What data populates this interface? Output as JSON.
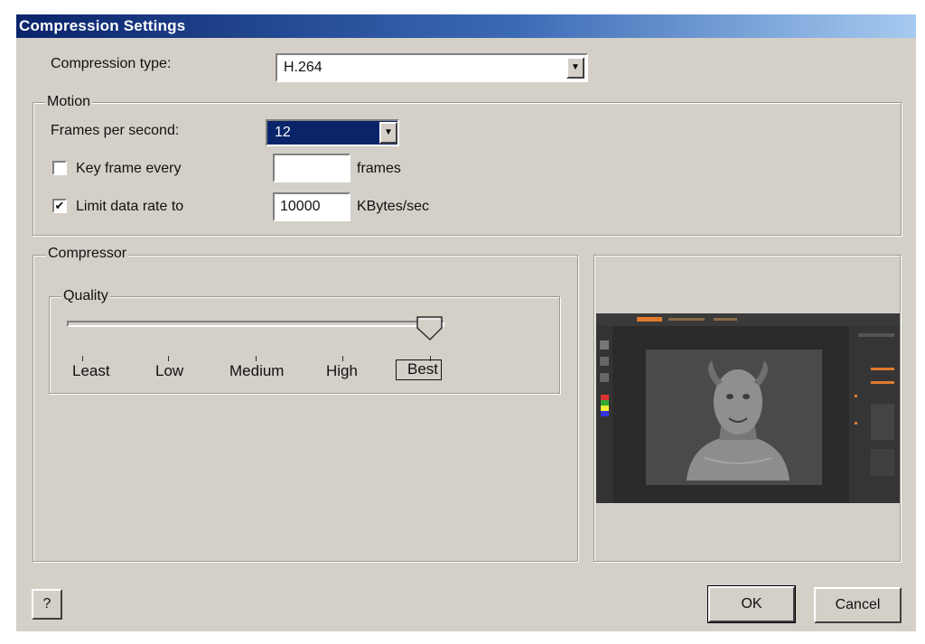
{
  "window": {
    "title": "Compression Settings"
  },
  "compression": {
    "label": "Compression type:",
    "value": "H.264",
    "dropdown_icon": "chevron-down-icon"
  },
  "motion": {
    "group_title": "Motion",
    "fps_label": "Frames per second:",
    "fps_value": "12",
    "keyframe_label": "Key frame every",
    "keyframe_checked": false,
    "keyframe_value": "",
    "keyframe_unit": "frames",
    "limit_label": "Limit data rate to",
    "limit_checked": true,
    "limit_value": "10000",
    "limit_unit": "KBytes/sec",
    "check_mark": "✔"
  },
  "compressor": {
    "group_title": "Compressor",
    "quality": {
      "title": "Quality",
      "levels": [
        "Least",
        "Low",
        "Medium",
        "High",
        "Best"
      ],
      "selected": "Best",
      "selected_index": 4
    },
    "preview_icon": "3d-bust-preview-thumbnail"
  },
  "buttons": {
    "help": "?",
    "ok": "OK",
    "cancel": "Cancel"
  },
  "colors": {
    "title_bar_start": "#0a246a",
    "title_bar_end": "#a6caf0",
    "dialog_bg": "#d4d0c8",
    "selected_highlight": "#0a246a"
  }
}
